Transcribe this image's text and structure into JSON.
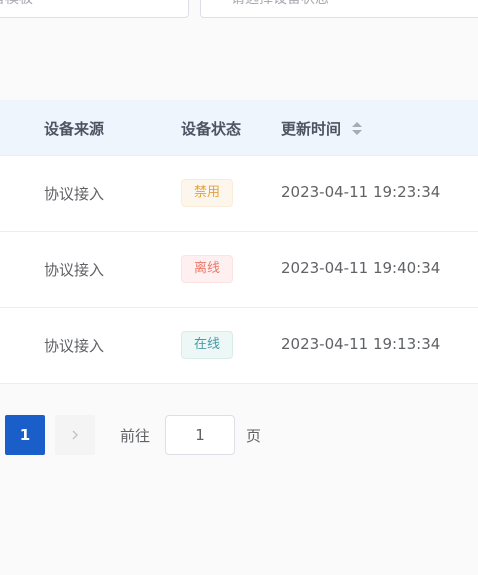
{
  "filters": {
    "template_placeholder": "备模板",
    "status_placeholder": "请选择设备状态"
  },
  "table": {
    "headers": {
      "source": "设备来源",
      "status": "设备状态",
      "updated_time": "更新时间"
    },
    "rows": [
      {
        "source": "协议接入",
        "status": "禁用",
        "status_type": "disabled",
        "updated_time": "2023-04-11 19:23:34"
      },
      {
        "source": "协议接入",
        "status": "离线",
        "status_type": "offline",
        "updated_time": "2023-04-11 19:40:34"
      },
      {
        "source": "协议接入",
        "status": "在线",
        "status_type": "online",
        "updated_time": "2023-04-11 19:13:34"
      }
    ],
    "sort_icon": "sort-caret-icon"
  },
  "pagination": {
    "current_page": "1",
    "next_icon": "chevron-right-icon",
    "goto_label": "前往",
    "goto_value": "1",
    "goto_suffix": "页"
  },
  "colors": {
    "primary": "#1a5fc9",
    "header_bg": "#eef5fc",
    "tag_disabled": "#e6a23c",
    "tag_offline": "#e87a6b",
    "tag_online": "#4a9aa8"
  }
}
